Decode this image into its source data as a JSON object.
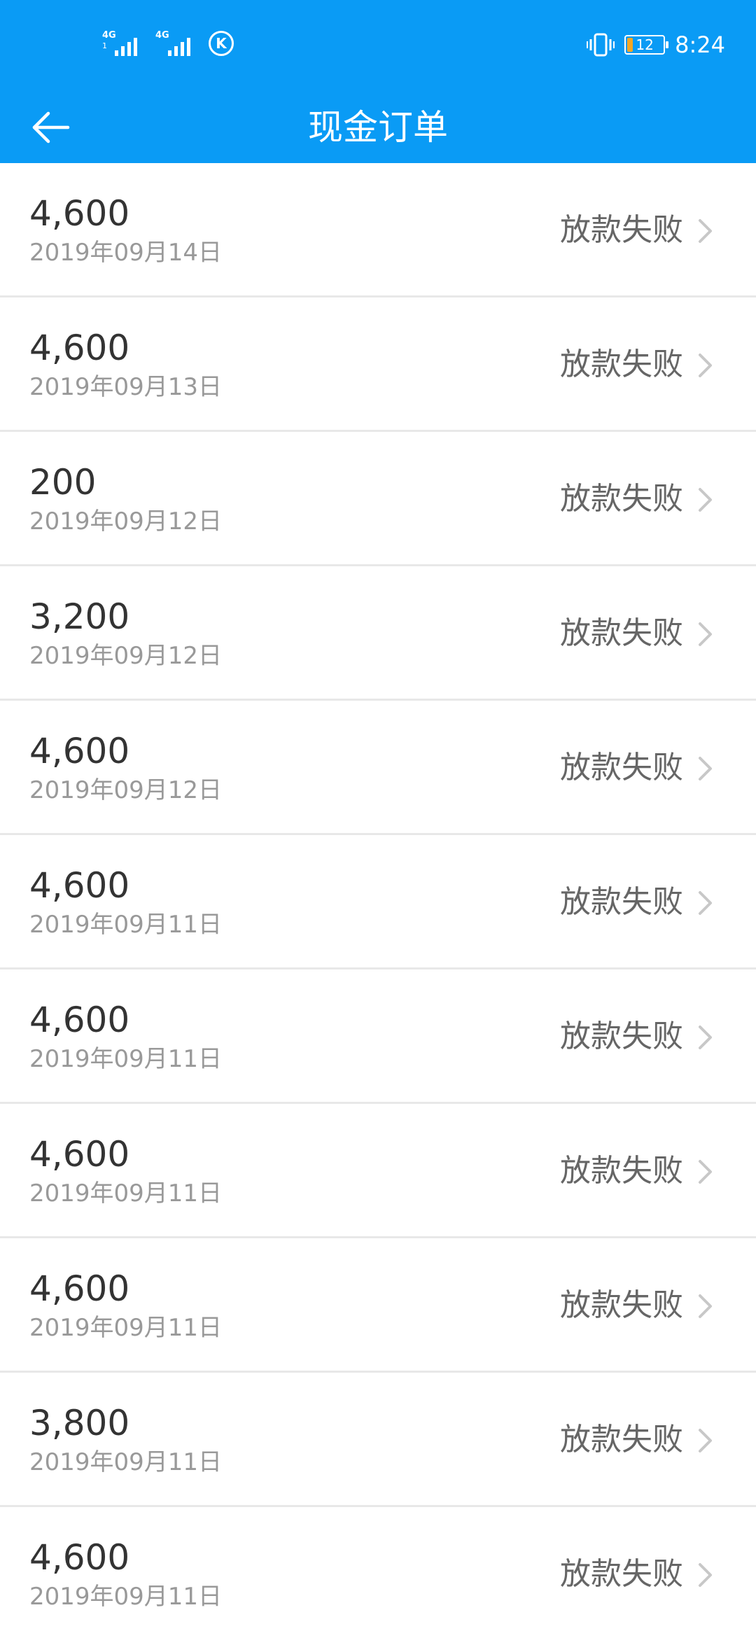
{
  "status_bar": {
    "signal_tag": "4G",
    "signal_tag2": "1",
    "k_label": "K",
    "battery_level": "12",
    "time": "8:24"
  },
  "title_bar": {
    "title": "现金订单"
  },
  "colors": {
    "header_bg": "#0A9BF5",
    "battery_fill": "#F5A623"
  },
  "orders": [
    {
      "amount": "4,600",
      "date": "2019年09月14日",
      "status": "放款失败"
    },
    {
      "amount": "4,600",
      "date": "2019年09月13日",
      "status": "放款失败"
    },
    {
      "amount": "200",
      "date": "2019年09月12日",
      "status": "放款失败"
    },
    {
      "amount": "3,200",
      "date": "2019年09月12日",
      "status": "放款失败"
    },
    {
      "amount": "4,600",
      "date": "2019年09月12日",
      "status": "放款失败"
    },
    {
      "amount": "4,600",
      "date": "2019年09月11日",
      "status": "放款失败"
    },
    {
      "amount": "4,600",
      "date": "2019年09月11日",
      "status": "放款失败"
    },
    {
      "amount": "4,600",
      "date": "2019年09月11日",
      "status": "放款失败"
    },
    {
      "amount": "4,600",
      "date": "2019年09月11日",
      "status": "放款失败"
    },
    {
      "amount": "3,800",
      "date": "2019年09月11日",
      "status": "放款失败"
    },
    {
      "amount": "4,600",
      "date": "2019年09月11日",
      "status": "放款失败"
    }
  ]
}
